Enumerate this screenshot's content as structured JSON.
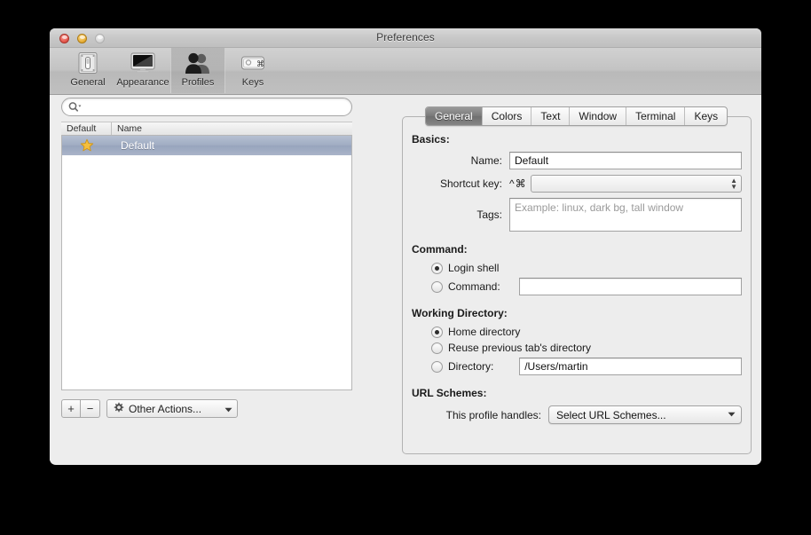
{
  "window": {
    "title": "Preferences",
    "traffic_lights": [
      {
        "name": "close",
        "color": "#e4564b"
      },
      {
        "name": "minimize",
        "color": "#e8ae35"
      },
      {
        "name": "zoom",
        "color": "#d6d6d6"
      }
    ]
  },
  "toolbar": {
    "items": [
      {
        "label": "General",
        "icon": "light-switch-icon",
        "selected": false
      },
      {
        "label": "Appearance",
        "icon": "display-monitor-icon",
        "selected": false
      },
      {
        "label": "Profiles",
        "icon": "two-people-icon",
        "selected": true
      },
      {
        "label": "Keys",
        "icon": "keyboard-key-icon",
        "selected": false
      }
    ]
  },
  "sidebar": {
    "search": {
      "value": "",
      "placeholder": ""
    },
    "columns": [
      "Default",
      "Name"
    ],
    "rows": [
      {
        "default_star": "★",
        "name": "Default",
        "selected": true
      }
    ],
    "bottom_toolbar": {
      "add_label": "+",
      "remove_label": "−",
      "other_actions_label": "Other Actions...",
      "other_actions_arrow": "▼"
    }
  },
  "tabs": [
    {
      "label": "General",
      "selected": true
    },
    {
      "label": "Colors",
      "selected": false
    },
    {
      "label": "Text",
      "selected": false
    },
    {
      "label": "Window",
      "selected": false
    },
    {
      "label": "Terminal",
      "selected": false
    },
    {
      "label": "Keys",
      "selected": false
    }
  ],
  "general_panel": {
    "basics": {
      "title": "Basics:",
      "name_label": "Name:",
      "name_value": "Default",
      "shortcut_label": "Shortcut key:",
      "shortcut_modifiers": "^⌘",
      "shortcut_value": "",
      "tags_label": "Tags:",
      "tags_value": "",
      "tags_placeholder": "Example: linux, dark bg, tall window"
    },
    "command": {
      "title": "Command:",
      "login_shell_label": "Login shell",
      "login_shell_selected": true,
      "command_label": "Command:",
      "command_selected": false,
      "command_value": ""
    },
    "working_directory": {
      "title": "Working Directory:",
      "home_label": "Home directory",
      "home_selected": true,
      "reuse_label": "Reuse previous tab's directory",
      "reuse_selected": false,
      "directory_label": "Directory:",
      "directory_selected": false,
      "directory_value": "/Users/martin"
    },
    "url_schemes": {
      "title": "URL Schemes:",
      "handles_label": "This profile handles:",
      "popup_value": "Select URL Schemes...",
      "popup_arrow": "▼"
    }
  }
}
